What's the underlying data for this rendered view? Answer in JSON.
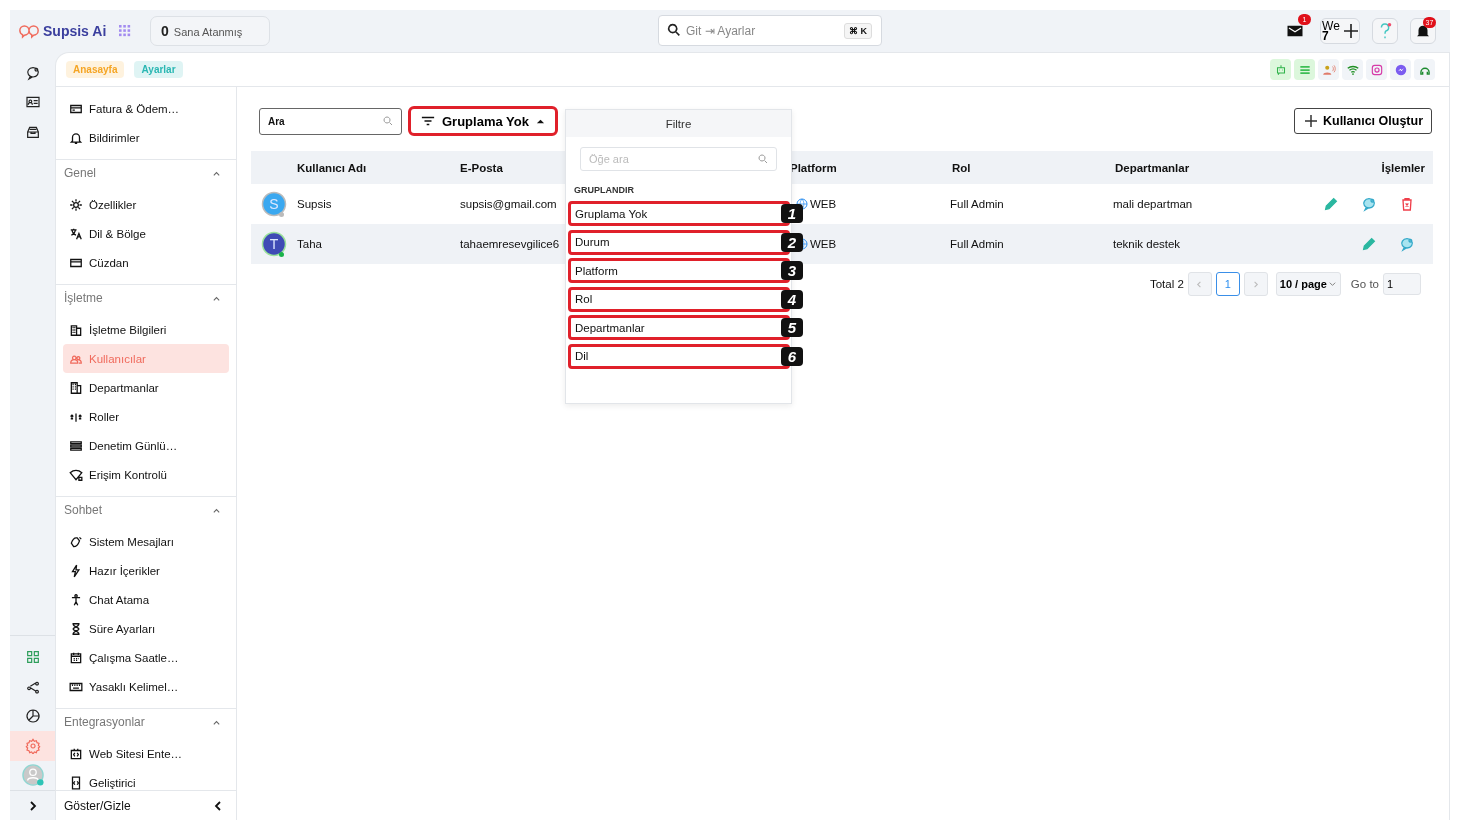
{
  "brand": {
    "name": "Supsis Ai"
  },
  "assigned": {
    "count": "0",
    "label": "Sana Atanmış"
  },
  "search": {
    "placeholder": "Git ⇥ Ayarlar",
    "shortcut": "⌘ K"
  },
  "header": {
    "mail_badge": "1",
    "workspace": "We",
    "workspace_count": "7",
    "bell_badge": "37"
  },
  "rail": [
    {
      "kind": "chat",
      "selected": false
    },
    {
      "kind": "contact",
      "selected": false
    },
    {
      "kind": "inbox",
      "selected": false
    },
    {
      "kind": "apps",
      "selected": false
    },
    {
      "kind": "share",
      "selected": false
    },
    {
      "kind": "chart",
      "selected": false
    },
    {
      "kind": "settings",
      "selected": true
    }
  ],
  "breadcrumbs": [
    {
      "label": "Anasayfa",
      "color": "#f5a524"
    },
    {
      "label": "Ayarlar",
      "color": "#2ab7b3"
    }
  ],
  "sidebar": {
    "top_items": [
      {
        "label": "Fatura & Ödem…",
        "selected": false
      },
      {
        "label": "Bildirimler",
        "selected": false
      }
    ],
    "sections": [
      {
        "title": "Genel",
        "expanded": true,
        "items": [
          {
            "label": "Özellikler",
            "selected": false
          },
          {
            "label": "Dil & Bölge",
            "selected": false
          },
          {
            "label": "Cüzdan",
            "selected": false
          }
        ]
      },
      {
        "title": "İşletme",
        "expanded": true,
        "items": [
          {
            "label": "İşletme Bilgileri",
            "selected": false
          },
          {
            "label": "Kullanıcılar",
            "selected": true
          },
          {
            "label": "Departmanlar",
            "selected": false
          },
          {
            "label": "Roller",
            "selected": false
          },
          {
            "label": "Denetim Günlü…",
            "selected": false
          },
          {
            "label": "Erişim Kontrolü",
            "selected": false
          }
        ]
      },
      {
        "title": "Sohbet",
        "expanded": true,
        "items": [
          {
            "label": "Sistem Mesajları",
            "selected": false
          },
          {
            "label": "Hazır İçerikler",
            "selected": false
          },
          {
            "label": "Chat Atama",
            "selected": false
          },
          {
            "label": "Süre Ayarları",
            "selected": false
          },
          {
            "label": "Çalışma Saatle…",
            "selected": false
          },
          {
            "label": "Yasaklı Kelimel…",
            "selected": false
          }
        ]
      },
      {
        "title": "Entegrasyonlar",
        "expanded": true,
        "items": [
          {
            "label": "Web Sitesi Ente…",
            "selected": false
          },
          {
            "label": "Geliştirici",
            "selected": false
          }
        ]
      }
    ],
    "footer": "Göster/Gizle"
  },
  "toolbar": {
    "search_placeholder": "Ara",
    "group_button": {
      "label": "Gruplama Yok",
      "highlighted": true,
      "open": true
    },
    "create_button": "Kullanıcı Oluştur"
  },
  "table": {
    "columns": [
      "Kullanıcı Adı",
      "E-Posta",
      "Platform",
      "Rol",
      "Departmanlar",
      "İşlemler"
    ],
    "rows": [
      {
        "avatar": "S",
        "color": "#3aa8f0",
        "online": false,
        "name": "Supsis",
        "email": "supsis@gmail.com",
        "platform": "WEB",
        "role": "Full Admin",
        "department": "mali departman",
        "deletable": true
      },
      {
        "avatar": "T",
        "color": "#3f4bb5",
        "online": true,
        "name": "Taha",
        "email": "tahaemresevgilice6",
        "platform": "WEB",
        "role": "Full Admin",
        "department": "teknik destek",
        "deletable": false
      }
    ]
  },
  "pagination": {
    "total": "Total 2",
    "pages": [
      {
        "label": "1",
        "selected": true
      }
    ],
    "page_size": "10 / page",
    "goto_label": "Go to",
    "goto_value": "1"
  },
  "dropdown": {
    "title": "Filtre",
    "search_placeholder": "Öğe ara",
    "group_label": "GRUPLANDIR",
    "options": [
      {
        "label": "Gruplama Yok",
        "marker": "1",
        "highlighted": true
      },
      {
        "label": "Durum",
        "marker": "2",
        "highlighted": true
      },
      {
        "label": "Platform",
        "marker": "3",
        "highlighted": true
      },
      {
        "label": "Rol",
        "marker": "4",
        "highlighted": true
      },
      {
        "label": "Departmanlar",
        "marker": "5",
        "highlighted": true
      },
      {
        "label": "Dil",
        "marker": "6",
        "highlighted": true
      }
    ]
  }
}
